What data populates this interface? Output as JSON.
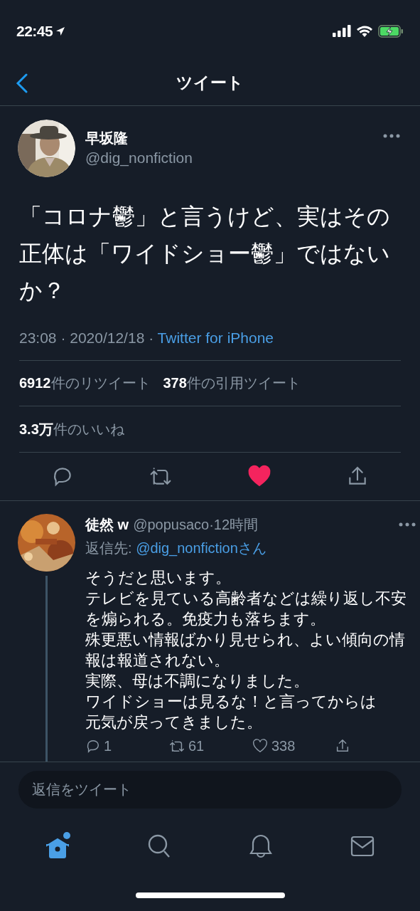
{
  "status_bar": {
    "time": "22:45"
  },
  "header": {
    "title": "ツイート"
  },
  "tweet": {
    "author": {
      "name": "早坂隆",
      "handle": "@dig_nonfiction"
    },
    "text": "「コロナ鬱」と言うけど、実はその正体は「ワイドショー鬱」ではないか？",
    "time": "23:08 · 2020/12/18 · ",
    "client": "Twitter for iPhone",
    "stats": [
      {
        "count": "6912",
        "label": "件のリツイート"
      },
      {
        "count": "378",
        "label": "件の引用ツイート"
      }
    ],
    "likes": {
      "count": "3.3万",
      "label": "件のいいね"
    },
    "liked": true
  },
  "reply": {
    "name": "徒然 w",
    "handle": "@popusaco",
    "age": "·12時間",
    "reply_to_label": "返信先: ",
    "reply_to": "@dig_nonfictionさん",
    "lines": [
      "そうだと思います。",
      "テレビを見ている高齢者などは繰り返し不安を煽られる。免疫力も落ちます。",
      "殊更悪い情報ばかり見せられ、よい傾向の情報は報道されない。",
      "実際、母は不調になりました。",
      "ワイドショーは見るな！と言ってからは",
      "元気が戻ってきました。"
    ],
    "counts": {
      "replies": "1",
      "retweets": "61",
      "likes": "338"
    }
  },
  "composer": {
    "placeholder": "返信をツイート"
  },
  "tabs": [
    {
      "kind": "home",
      "selected": true,
      "badge": true
    },
    {
      "kind": "search",
      "selected": false
    },
    {
      "kind": "notifications",
      "selected": false
    },
    {
      "kind": "messages",
      "selected": false
    }
  ]
}
